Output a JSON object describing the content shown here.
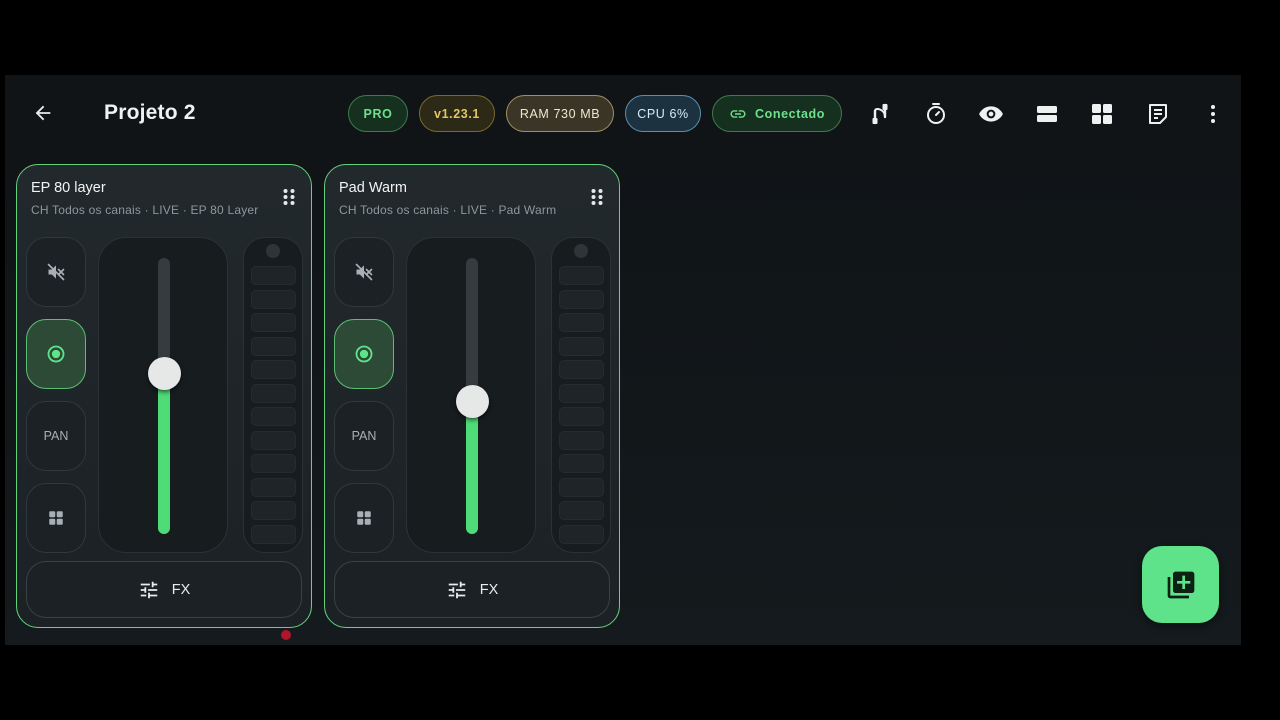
{
  "appbar": {
    "title": "Projeto 2",
    "chips": {
      "pro": "PRO",
      "version": "v1.23.1",
      "ram": "RAM 730 MB",
      "cpu": "CPU 6%",
      "connection": "Conectado"
    },
    "icons": [
      "back-arrow-icon",
      "routing-icon",
      "timer-icon",
      "eye-icon",
      "rows-layout-icon",
      "grid-layout-icon",
      "notes-icon",
      "more-vert-icon"
    ]
  },
  "channels": [
    {
      "title": "EP 80 layer",
      "subtitle": "CH Todos os canais · LIVE · EP 80 Layer",
      "pan_label": "PAN",
      "fx_label": "FX",
      "fader_level": 0.58,
      "mute": true,
      "monitor_active": true
    },
    {
      "title": "Pad Warm",
      "subtitle": "CH Todos os canais · LIVE · Pad Warm",
      "pan_label": "PAN",
      "fx_label": "FX",
      "fader_level": 0.48,
      "mute": true,
      "monitor_active": true
    }
  ],
  "colors": {
    "accent": "#5ee38a",
    "card_border": "#65d27e",
    "background": "#12171a"
  }
}
